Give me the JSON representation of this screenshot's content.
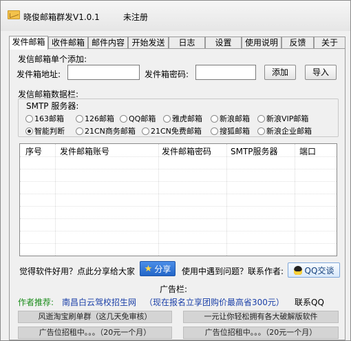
{
  "window": {
    "title": "晓俊邮箱群发V1.0.1",
    "status": "未注册"
  },
  "tabs": [
    "发件邮箱",
    "收件邮箱",
    "邮件内容",
    "开始发送",
    "日志",
    "设置",
    "使用说明",
    "反馈",
    "关于"
  ],
  "add_section": {
    "heading": "发信邮箱单个添加:",
    "address_label": "发件箱地址:",
    "password_label": "发件箱密码:",
    "address_value": "",
    "password_value": "",
    "add_button": "添加",
    "import_button": "导入"
  },
  "data_section": {
    "heading": "发信邮箱数据栏:",
    "smtp_label": "SMTP 服务器:",
    "radios_row1": [
      "163邮箱",
      "126邮箱",
      "QQ邮箱",
      "雅虎邮箱",
      "新浪邮箱",
      "新浪VIP邮箱"
    ],
    "radios_row2": [
      "智能判断",
      "21CN商务邮箱",
      "21CN免费邮箱",
      "搜狐邮箱",
      "新浪企业邮箱"
    ],
    "selected": "智能判断",
    "table_headers": [
      "序号",
      "发件邮箱账号",
      "发件邮箱密码",
      "SMTP服务器",
      "端口"
    ]
  },
  "footer": {
    "share_prompt": "觉得软件好用？点此分享给大家",
    "share_button": "分享",
    "help_prompt": "使用中遇到问题？联系作者:",
    "qq_button": "QQ交谈",
    "ad_heading": "广告栏:",
    "author_recommend": "作者推荐:",
    "ad_link": "南昌白云驾校招生网",
    "ad_promo": "（现在报名立享团购价最高省300元）",
    "contact": "联系QQ",
    "ad_buttons": [
      "风逝淘宝刷单群（这几天免审核）",
      "一元让你轻松拥有各大破解版软件",
      "广告位招租中。。。（20元一个月）",
      "广告位招租中。。。（20元一个月）"
    ]
  },
  "colors": {
    "share_blue": "#2f74d6",
    "green_text": "#1a8c1a",
    "link_blue": "#1a3fa8"
  }
}
